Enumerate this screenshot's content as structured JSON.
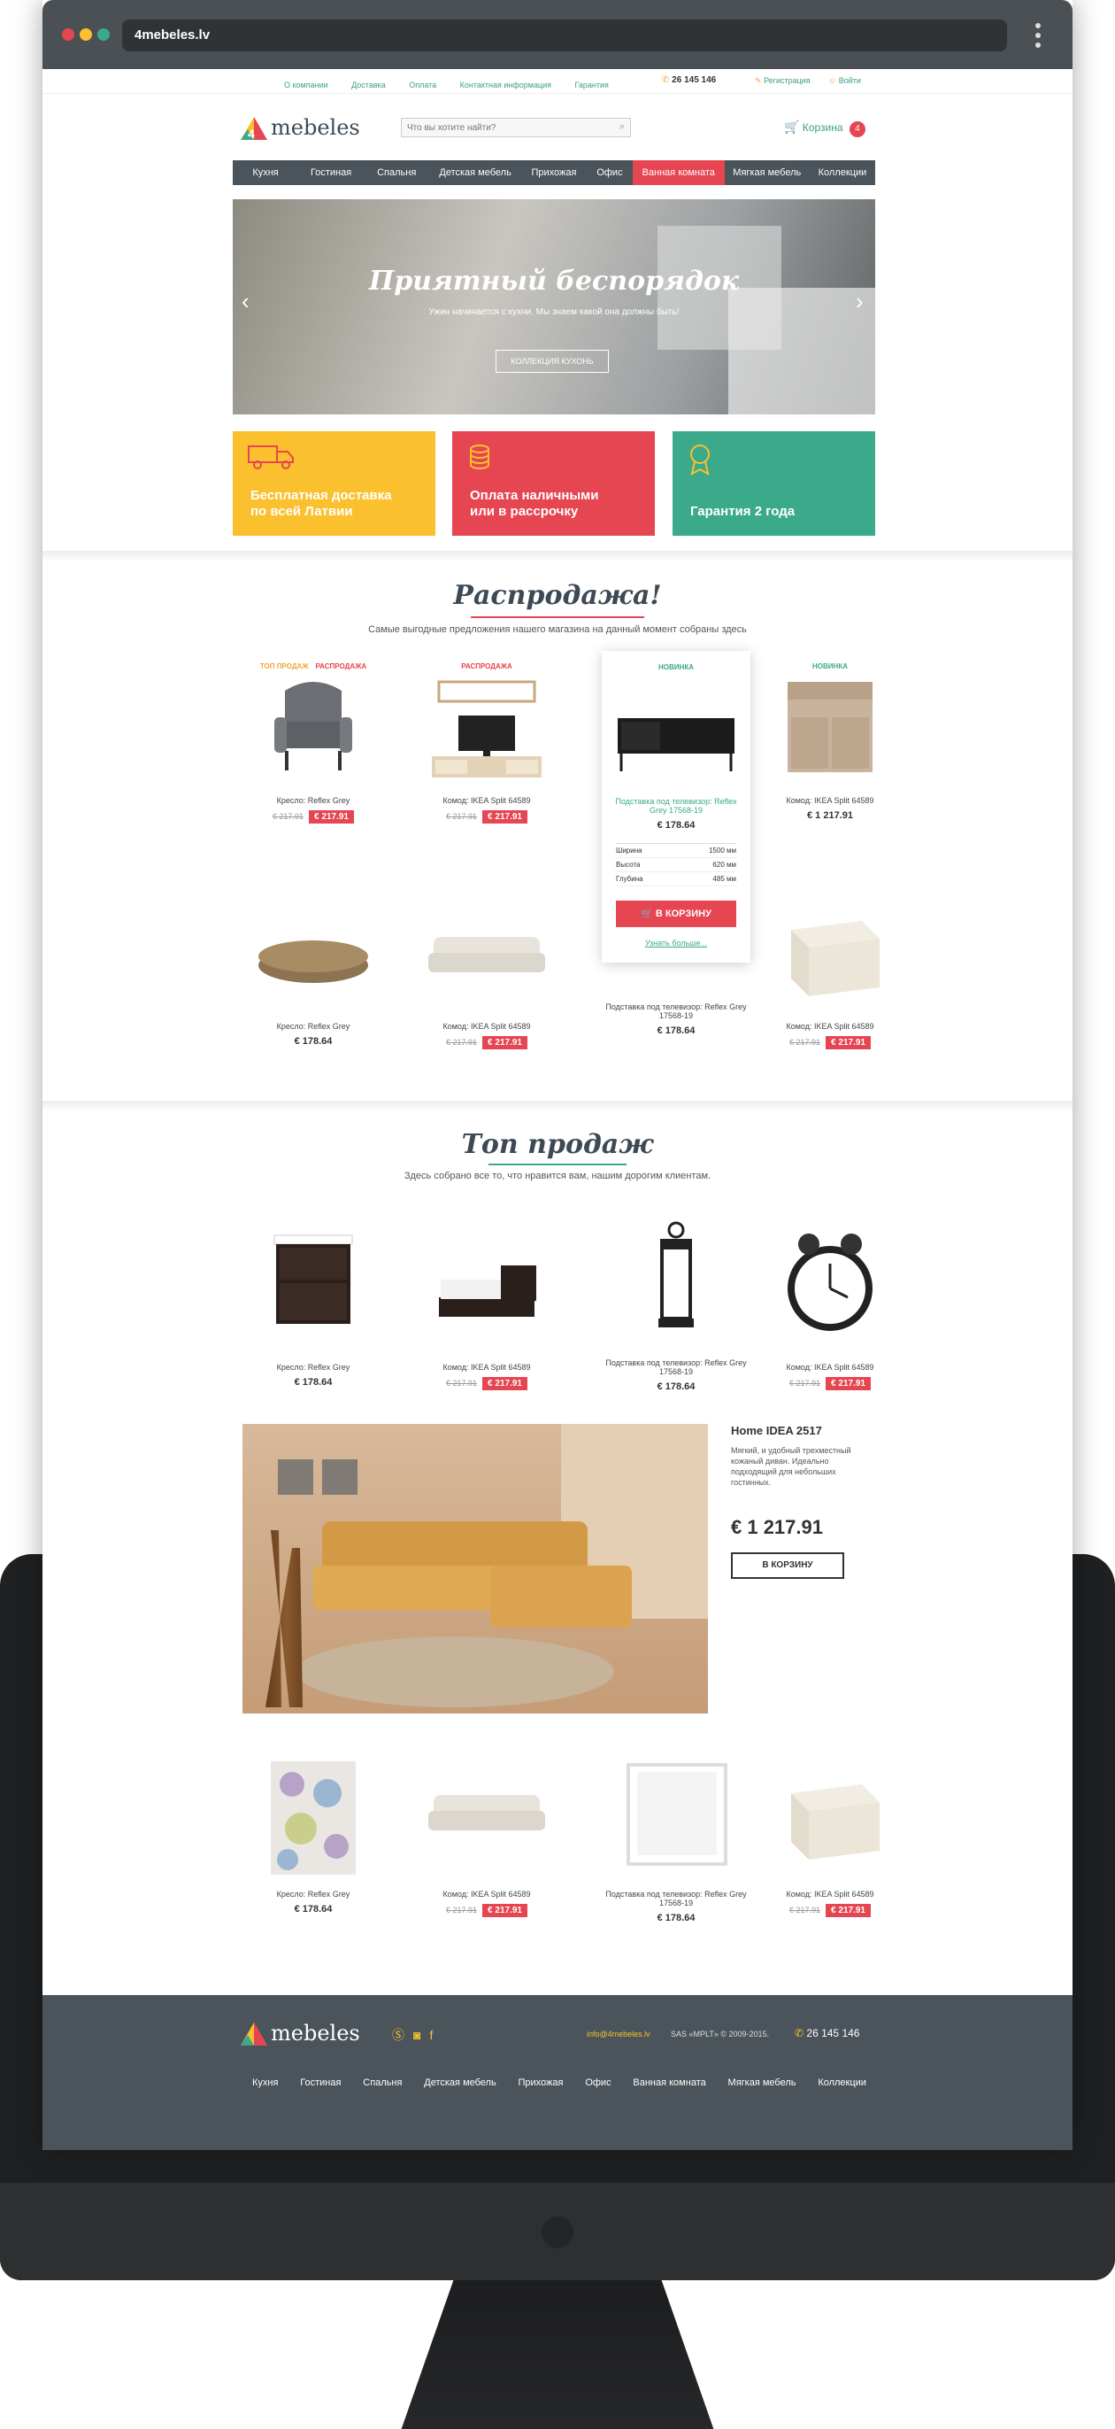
{
  "browser": {
    "url": "4mebeles.lv"
  },
  "topbar": {
    "links": [
      "О компании",
      "Доставка",
      "Оплата",
      "Контактная информация",
      "Гарантия"
    ],
    "phone": "26 145 146",
    "register": "Регистрация",
    "login": "Войти"
  },
  "header": {
    "logo_text": "mebeles",
    "search_placeholder": "Что вы хотите найти?",
    "cart_label": "Корзина",
    "cart_count": "4"
  },
  "nav": {
    "items": [
      "Кухня",
      "Гостиная",
      "Спальня",
      "Детская мебель",
      "Прихожая",
      "Офис",
      "Ванная комната",
      "Мягкая мебель",
      "Коллекции"
    ],
    "active": "Ванная комната"
  },
  "hero": {
    "title": "Приятный беспорядок",
    "subtitle": "Ужин начинается с кухни. Мы знаем какой она должны быть!",
    "button": "Коллекция кухонь"
  },
  "features": [
    {
      "text": "Бесплатная доставка по всей Латвии",
      "color": "#fbc02d"
    },
    {
      "text": "Оплата наличными или в рассрочку",
      "color": "#e64552"
    },
    {
      "text": "Гарантия 2 года",
      "color": "#3aaa8a"
    }
  ],
  "sale": {
    "title": "Распродажа!",
    "subtitle": "Самые выгодные предложения нашего магазина на данный момент собраны здесь",
    "row1": [
      {
        "badges": [
          "ТОП ПРОДАЖ",
          "РАСПРОДАЖА"
        ],
        "name": "Кресло: Reflex Grey",
        "old": "€ 217.91",
        "price": "€ 217.91"
      },
      {
        "badges": [
          "РАСПРОДАЖА"
        ],
        "name": "Комод: IKEA Split 64589",
        "old": "€ 217.91",
        "price": "€ 217.91"
      },
      {
        "badges": [
          "НОВИНКА"
        ],
        "name": "Подставка под телевизор: Reflex Grey 17568-19",
        "old": "",
        "price": "€ 178.64"
      },
      {
        "badges": [
          "НОВИНКА"
        ],
        "name": "Комод: IKEA Split 64589",
        "old": "",
        "price": "€ 1 217.91"
      }
    ],
    "specs": [
      [
        "Ширина",
        "1500 мм"
      ],
      [
        "Высота",
        "620 мм"
      ],
      [
        "Глубина",
        "485 мм"
      ]
    ],
    "cart_button": "В КОРЗИНУ",
    "more": "Узнать больше...",
    "row2": [
      {
        "name": "Кресло: Reflex Grey",
        "old": "",
        "price": "€ 178.64"
      },
      {
        "name": "Комод: IKEA Split 64589",
        "old": "€ 217.91",
        "price": "€ 217.91"
      },
      {
        "name": "Подставка под телевизор: Reflex Grey 17568-19",
        "old": "",
        "price": "€ 178.64"
      },
      {
        "name": "Комод: IKEA Split 64589",
        "old": "€ 217.91",
        "price": "€ 217.91"
      }
    ]
  },
  "top": {
    "title": "Топ продаж",
    "subtitle": "Здесь собрано все то, что нравится вам, нашим дорогим клиентам.",
    "row1": [
      {
        "name": "Кресло: Reflex Grey",
        "old": "",
        "price": "€ 178.64"
      },
      {
        "name": "Комод: IKEA Split 64589",
        "old": "€ 217.91",
        "price": "€ 217.91"
      },
      {
        "name": "Подставка под телевизор: Reflex Grey 17568-19",
        "old": "",
        "price": "€ 178.64"
      },
      {
        "name": "Комод: IKEA Split 64589",
        "old": "€ 217.91",
        "price": "€ 217.91"
      }
    ],
    "feature": {
      "title": "Home IDEA 2517",
      "desc": "Мягкий, и удобный трехместный кожаный диван. Идеально подходящий для небольших гостинных.",
      "price": "€ 1 217.91",
      "button": "В КОРЗИНУ"
    },
    "row2": [
      {
        "name": "Кресло: Reflex Grey",
        "old": "",
        "price": "€ 178.64"
      },
      {
        "name": "Комод: IKEA Split 64589",
        "old": "€ 217.91",
        "price": "€ 217.91"
      },
      {
        "name": "Подставка под телевизор: Reflex Grey 17568-19",
        "old": "",
        "price": "€ 178.64"
      },
      {
        "name": "Комод: IKEA Split 64589",
        "old": "€ 217.91",
        "price": "€ 217.91"
      }
    ]
  },
  "footer": {
    "email": "info@4mebeles.lv",
    "copyright": "SAS «MPLT» © 2009-2015.",
    "phone": "26 145 146",
    "nav": [
      "Кухня",
      "Гостиная",
      "Спальня",
      "Детская мебель",
      "Прихожая",
      "Офис",
      "Ванная комната",
      "Мягкая мебель",
      "Коллекции"
    ]
  }
}
